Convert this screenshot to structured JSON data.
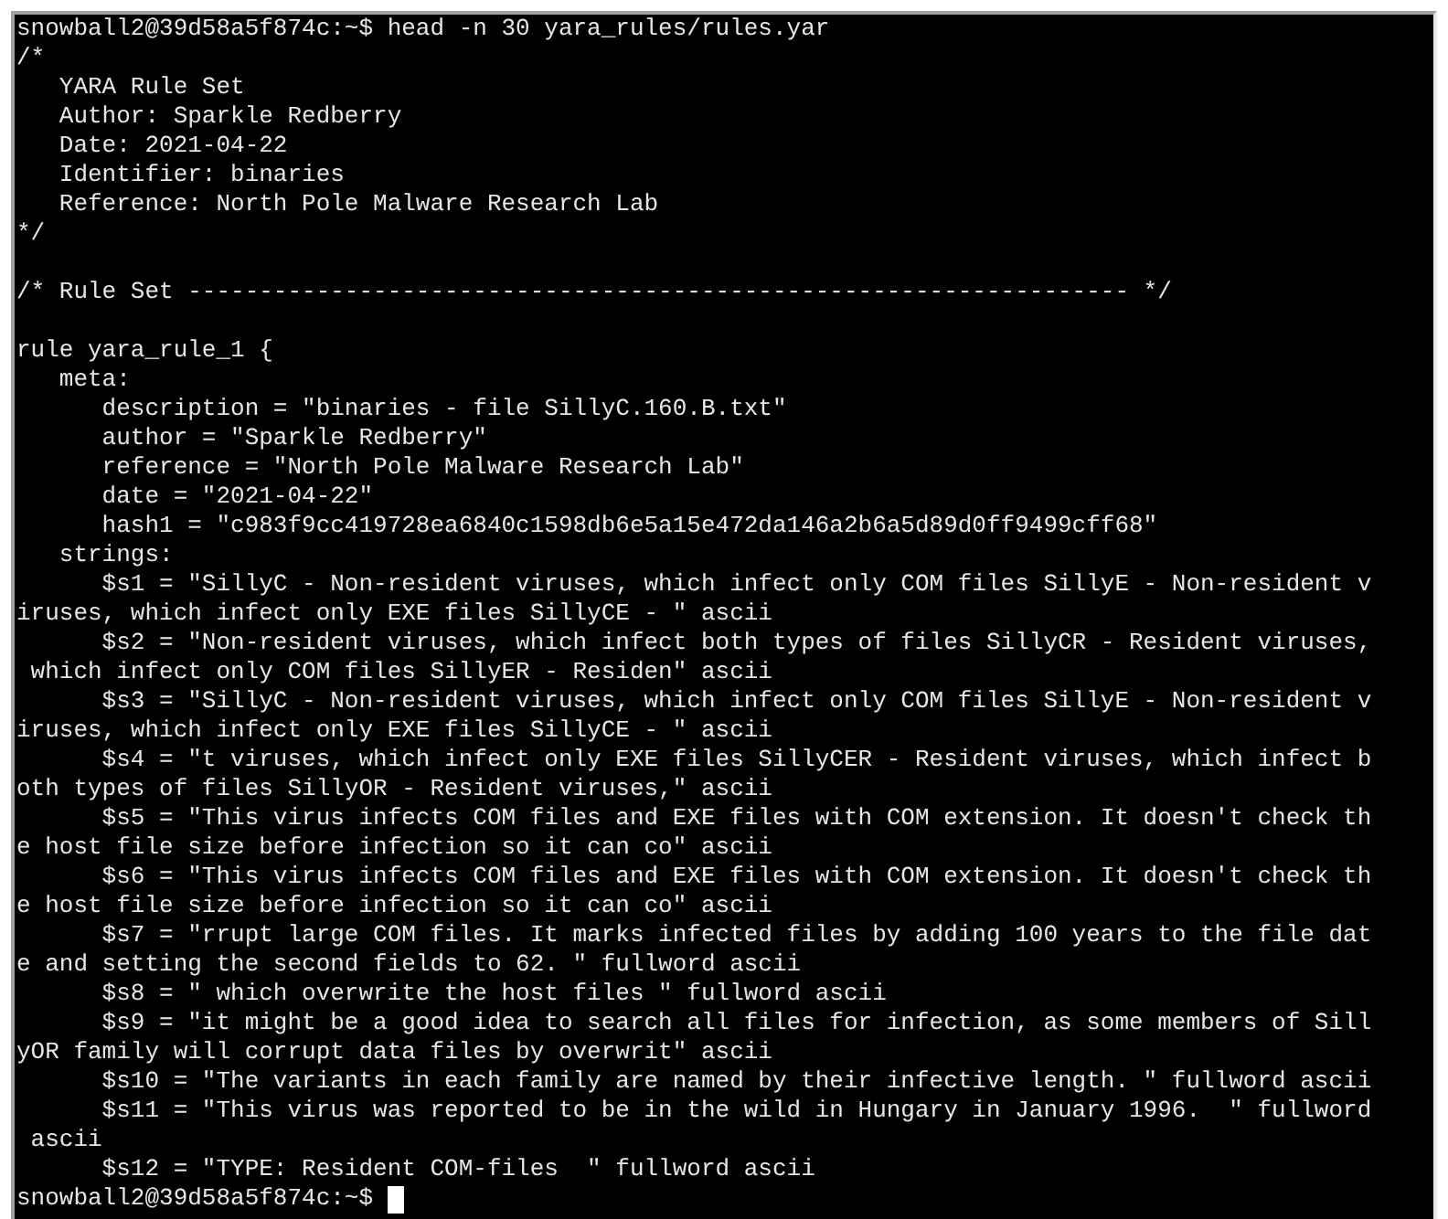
{
  "terminal": {
    "lines": [
      {
        "kind": "command",
        "text": "snowball2@39d58a5f874c:~$ head -n 30 yara_rules/rules.yar"
      },
      {
        "kind": "output",
        "text": "/*"
      },
      {
        "kind": "output",
        "text": "   YARA Rule Set"
      },
      {
        "kind": "output",
        "text": "   Author: Sparkle Redberry"
      },
      {
        "kind": "output",
        "text": "   Date: 2021-04-22"
      },
      {
        "kind": "output",
        "text": "   Identifier: binaries"
      },
      {
        "kind": "output",
        "text": "   Reference: North Pole Malware Research Lab"
      },
      {
        "kind": "output",
        "text": "*/"
      },
      {
        "kind": "output",
        "gap_before": true,
        "text": "/* Rule Set ------------------------------------------------------------------ */"
      },
      {
        "kind": "output",
        "gap_before": true,
        "text": "rule yara_rule_1 {"
      },
      {
        "kind": "output",
        "text": "   meta:"
      },
      {
        "kind": "output",
        "text": "      description = \"binaries - file SillyC.160.B.txt\""
      },
      {
        "kind": "output",
        "text": "      author = \"Sparkle Redberry\""
      },
      {
        "kind": "output",
        "text": "      reference = \"North Pole Malware Research Lab\""
      },
      {
        "kind": "output",
        "text": "      date = \"2021-04-22\""
      },
      {
        "kind": "output",
        "text": "      hash1 = \"c983f9cc419728ea6840c1598db6e5a15e472da146a2b6a5d89d0ff9499cff68\""
      },
      {
        "kind": "output",
        "text": "   strings:"
      },
      {
        "kind": "output",
        "text": "      $s1 = \"SillyC - Non-resident viruses, which infect only COM files SillyE - Non-resident v"
      },
      {
        "kind": "output",
        "text": "iruses, which infect only EXE files SillyCE - \" ascii"
      },
      {
        "kind": "output",
        "text": "      $s2 = \"Non-resident viruses, which infect both types of files SillyCR - Resident viruses,"
      },
      {
        "kind": "output",
        "text": " which infect only COM files SillyER - Residen\" ascii"
      },
      {
        "kind": "output",
        "text": "      $s3 = \"SillyC - Non-resident viruses, which infect only COM files SillyE - Non-resident v"
      },
      {
        "kind": "output",
        "text": "iruses, which infect only EXE files SillyCE - \" ascii"
      },
      {
        "kind": "output",
        "text": "      $s4 = \"t viruses, which infect only EXE files SillyCER - Resident viruses, which infect b"
      },
      {
        "kind": "output",
        "text": "oth types of files SillyOR - Resident viruses,\" ascii"
      },
      {
        "kind": "output",
        "text": "      $s5 = \"This virus infects COM files and EXE files with COM extension. It doesn't check th"
      },
      {
        "kind": "output",
        "text": "e host file size before infection so it can co\" ascii"
      },
      {
        "kind": "output",
        "text": "      $s6 = \"This virus infects COM files and EXE files with COM extension. It doesn't check th"
      },
      {
        "kind": "output",
        "text": "e host file size before infection so it can co\" ascii"
      },
      {
        "kind": "output",
        "text": "      $s7 = \"rrupt large COM files. It marks infected files by adding 100 years to the file dat"
      },
      {
        "kind": "output",
        "text": "e and setting the second fields to 62. \" fullword ascii"
      },
      {
        "kind": "output",
        "text": "      $s8 = \" which overwrite the host files \" fullword ascii"
      },
      {
        "kind": "output",
        "text": "      $s9 = \"it might be a good idea to search all files for infection, as some members of Sill"
      },
      {
        "kind": "output",
        "text": "yOR family will corrupt data files by overwrit\" ascii"
      },
      {
        "kind": "output",
        "text": "      $s10 = \"The variants in each family are named by their infective length. \" fullword ascii"
      },
      {
        "kind": "output",
        "text": "      $s11 = \"This virus was reported to be in the wild in Hungary in January 1996.  \" fullword"
      },
      {
        "kind": "output",
        "text": " ascii"
      },
      {
        "kind": "output",
        "text": "      $s12 = \"TYPE: Resident COM-files  \" fullword ascii"
      },
      {
        "kind": "prompt",
        "text": "snowball2@39d58a5f874c:~$",
        "cursor": true
      }
    ]
  }
}
